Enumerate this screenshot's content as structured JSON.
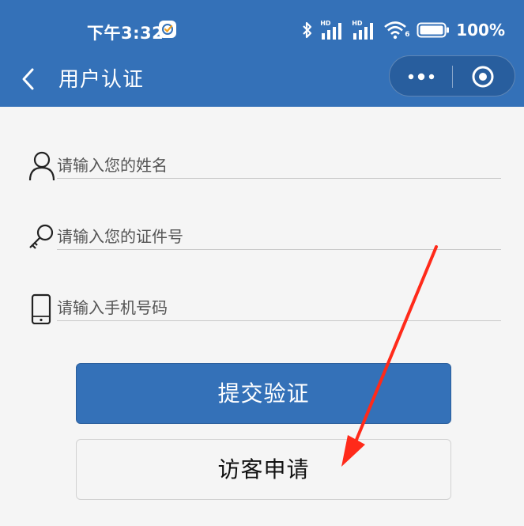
{
  "status_bar": {
    "time": "下午3:32",
    "network_label_1": "HD",
    "network_label_2": "HD",
    "wifi_sub": "6",
    "battery_text": "100%"
  },
  "nav": {
    "title": "用户认证"
  },
  "form": {
    "name_placeholder": "请输入您的姓名",
    "id_placeholder": "请输入您的证件号",
    "phone_placeholder": "请输入手机号码"
  },
  "buttons": {
    "submit_label": "提交验证",
    "visitor_label": "访客申请"
  },
  "colors": {
    "brand_blue": "#3471b8",
    "annotation_red": "#ff2a1a",
    "background": "#f5f5f5"
  }
}
